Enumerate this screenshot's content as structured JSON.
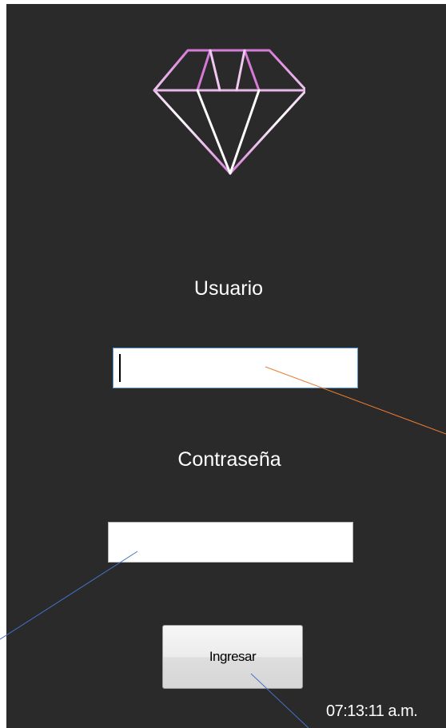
{
  "login": {
    "username_label": "Usuario",
    "username_value": "",
    "password_label": "Contraseña",
    "password_value": "",
    "submit_label": "Ingresar"
  },
  "status": {
    "clock": "07:13:11 a.m."
  },
  "logo": {
    "icon": "diamond-icon"
  },
  "colors": {
    "background": "#2a2a2a",
    "label_text": "#ffffff",
    "logo_stroke_light": "#ffffff",
    "logo_stroke_accent": "#d67ad8",
    "focus_border": "#5b9bd5",
    "annotation_orange": "#ed7d31",
    "annotation_blue": "#4472c4"
  }
}
